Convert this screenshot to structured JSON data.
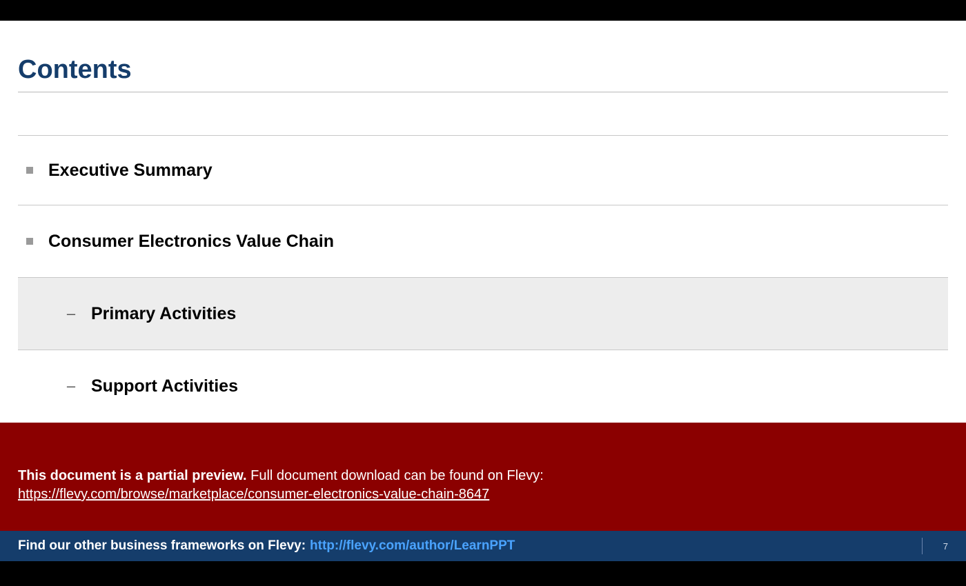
{
  "slide": {
    "title": "Contents",
    "items": [
      {
        "text": "Executive Summary",
        "level": 1,
        "highlight": false
      },
      {
        "text": "Consumer Electronics Value Chain",
        "level": 1,
        "highlight": false
      },
      {
        "text": "Primary Activities",
        "level": 2,
        "highlight": true
      },
      {
        "text": "Support Activities",
        "level": 2,
        "highlight": false
      }
    ]
  },
  "preview": {
    "lead": "This document is a partial preview.",
    "rest": "  Full document download can be found on Flevy:",
    "url": "https://flevy.com/browse/marketplace/consumer-electronics-value-chain-8647"
  },
  "footer": {
    "prefix": "Find our other business frameworks on Flevy:",
    "link_text": "http://flevy.com/author/LearnPPT",
    "page_number": "7"
  }
}
